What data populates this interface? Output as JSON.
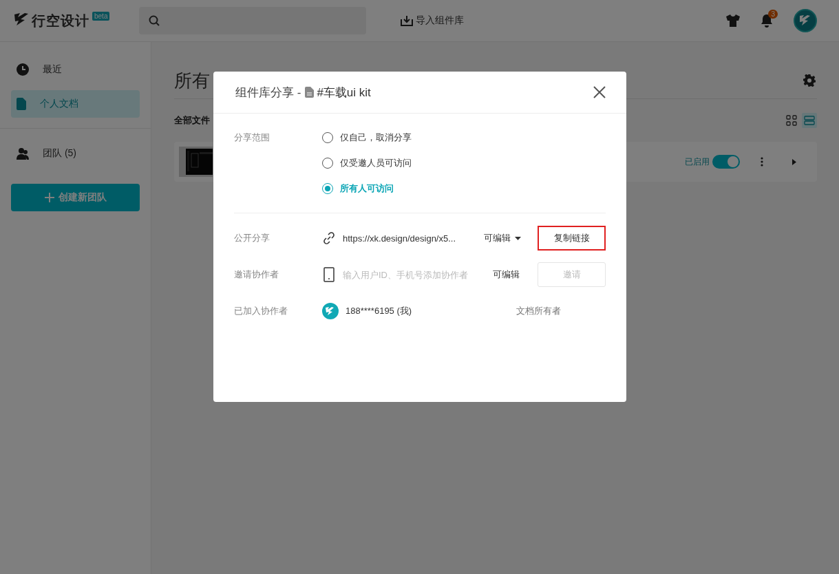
{
  "header": {
    "logo_text": "行空设计",
    "beta_badge": "beta",
    "import_button": "导入组件库",
    "notification_count": "3"
  },
  "sidebar": {
    "items": [
      {
        "label": "最近",
        "kind": "recent",
        "selected": false
      },
      {
        "label": "个人文档",
        "kind": "documents",
        "selected": true
      }
    ],
    "team": "团队 (5)",
    "create_team_button": "创建新团队"
  },
  "main": {
    "title": "所有",
    "filter_label": "全部文件",
    "view_modes": [
      {
        "kind": "grid",
        "selected": false
      },
      {
        "kind": "list",
        "selected": true
      }
    ],
    "files": [
      {
        "status": "已启用",
        "enabled": true
      }
    ]
  },
  "dialog": {
    "title": "组件库分享 -",
    "doc_name": "#车载ui kit",
    "scope_label": "分享范围",
    "scope_options": [
      {
        "label": "仅自己，取消分享",
        "selected": false
      },
      {
        "label": "仅受邀人员可访问",
        "selected": false
      },
      {
        "label": "所有人可访问",
        "selected": true
      }
    ],
    "public_label": "公开分享",
    "link": "https://xk.design/design/x5...",
    "link_permission": "可编辑",
    "copy_button": {
      "label": "复制链接",
      "highlighted": true
    },
    "invite_label": "邀请协作者",
    "invite_placeholder": "输入用户ID、手机号添加协作者",
    "invite_permission": "可编辑",
    "invite_button": {
      "label": "邀请",
      "disabled": true
    },
    "members_label": "已加入协作者",
    "members": [
      {
        "name": "188****6195 (我)",
        "role": "文档所有者"
      }
    ]
  }
}
